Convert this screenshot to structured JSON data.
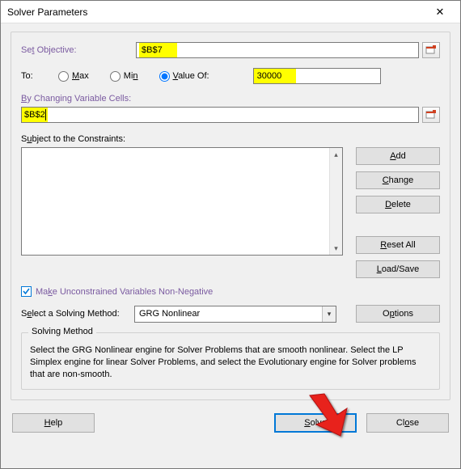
{
  "window": {
    "title": "Solver Parameters",
    "close": "✕"
  },
  "labels": {
    "set_objective_pre": "Se",
    "set_objective_u": "t",
    "set_objective_post": " Objective:",
    "to": "To:",
    "max_u": "M",
    "max_post": "ax",
    "min_pre": "Mi",
    "min_u": "n",
    "valueof_u": "V",
    "valueof_post": "alue Of:",
    "by_changing_u": "B",
    "by_changing_post": "y Changing Variable Cells:",
    "subject_pre": "S",
    "subject_u": "u",
    "subject_post": "bject to the Constraints:",
    "make_pre": "Ma",
    "make_u": "k",
    "make_post": "e Unconstrained Variables Non-Negative",
    "select_pre": "S",
    "select_u": "e",
    "select_post": "lect a Solving Method:",
    "method_frame": "Solving Method",
    "method_text": "Select the GRG Nonlinear engine for Solver Problems that are smooth nonlinear. Select the LP Simplex engine for linear Solver Problems, and select the Evolutionary engine for Solver problems that are non-smooth."
  },
  "values": {
    "objective": "$B$7",
    "value_of": "30000",
    "variable_cells": "$B$2",
    "solving_method": "GRG Nonlinear"
  },
  "radios": {
    "selected": "value_of"
  },
  "buttons": {
    "add_u": "A",
    "add_post": "dd",
    "change_u": "C",
    "change_post": "hange",
    "delete_u": "D",
    "delete_post": "elete",
    "reset_u": "R",
    "reset_post": "eset All",
    "loadsave_u": "L",
    "loadsave_post": "oad/Save",
    "options_pre": "O",
    "options_u": "p",
    "options_post": "tions",
    "help_u": "H",
    "help_post": "elp",
    "solve_u": "S",
    "solve_post": "olve",
    "close_pre": "Cl",
    "close_u": "o",
    "close_post": "se"
  }
}
